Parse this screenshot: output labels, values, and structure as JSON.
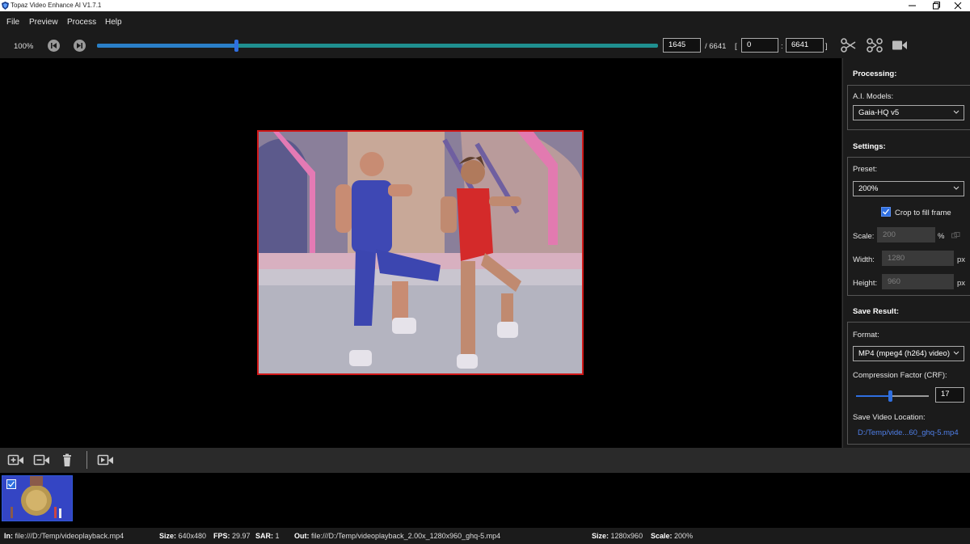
{
  "window": {
    "title": "Topaz Video Enhance AI V1.7.1",
    "controls": [
      "minimize-icon",
      "maximize-icon",
      "close-icon"
    ]
  },
  "menu": {
    "file": "File",
    "preview": "Preview",
    "process": "Process",
    "help": "Help"
  },
  "toolbar": {
    "zoom": "100%",
    "timeline_progress": 0.248,
    "current_frame": "1645",
    "total_frames": "/ 6641",
    "range_open": "[",
    "range_start": "0",
    "range_sep": ":",
    "range_end": "6641",
    "range_close": "]",
    "icons": [
      "skip-back-icon",
      "skip-forward-icon",
      "scissors-icon",
      "cut-segment-icon",
      "video-camera-icon"
    ]
  },
  "panel": {
    "processing_header": "Processing:",
    "ai_models_label": "A.I. Models:",
    "ai_model_value": "Gaia-HQ v5",
    "settings_header": "Settings:",
    "preset_label": "Preset:",
    "preset_value": "200%",
    "crop_label": "Crop to fill frame",
    "crop_checked": true,
    "scale_label": "Scale:",
    "scale_value": "200",
    "scale_unit": "%",
    "width_label": "Width:",
    "width_value": "1280",
    "width_unit": "px",
    "height_label": "Height:",
    "height_value": "960",
    "height_unit": "px",
    "save_header": "Save Result:",
    "format_label": "Format:",
    "format_value": "MP4 (mpeg4 (h264) video)",
    "crf_label": "Compression Factor (CRF):",
    "crf_value": "17",
    "crf_slider_fraction": 0.47,
    "location_label": "Save Video Location:",
    "location_value": "D:/Temp/vide...60_ghq-5.mp4"
  },
  "queue": {
    "icons": [
      "add-video-icon",
      "remove-video-icon",
      "delete-icon",
      "export-video-icon"
    ],
    "item_checked": true
  },
  "status": {
    "in_label": "In:",
    "in_value": "file:///D:/Temp/videoplayback.mp4",
    "size_label": "Size:",
    "in_size": "640x480",
    "fps_label": "FPS:",
    "fps": "29.97",
    "sar_label": "SAR:",
    "sar": "1",
    "out_label": "Out:",
    "out_value": "file:///D:/Temp/videoplayback_2.00x_1280x960_ghq-5.mp4",
    "out_size_label": "Size:",
    "out_size": "1280x960",
    "scale_label": "Scale:",
    "scale": "200%"
  },
  "colors": {
    "accent": "#2f6fe0",
    "frame_border": "#d01818",
    "timeline": "#1f8f8f",
    "link": "#4f7fe8"
  }
}
